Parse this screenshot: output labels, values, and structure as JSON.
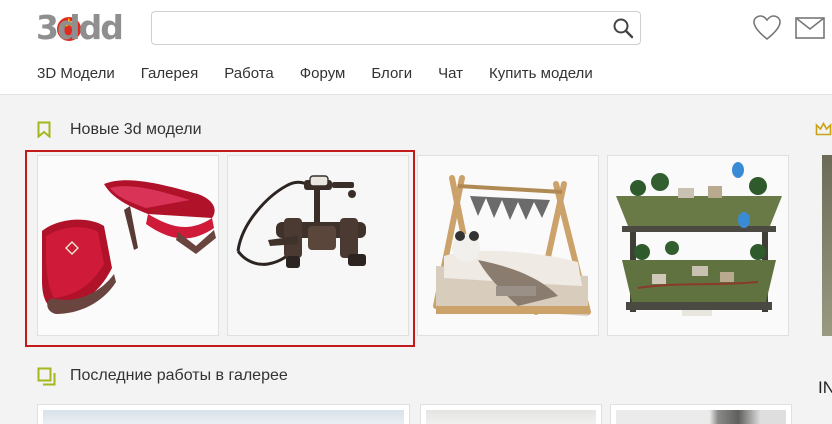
{
  "header": {
    "logo_text": "3ddd",
    "search": {
      "value": "",
      "placeholder": ""
    },
    "icons": [
      "search-icon",
      "heart-icon",
      "mail-icon"
    ]
  },
  "nav": {
    "items": [
      {
        "label": "3D Модели"
      },
      {
        "label": "Галерея"
      },
      {
        "label": "Работа"
      },
      {
        "label": "Форум"
      },
      {
        "label": "Блоги"
      },
      {
        "label": "Чат"
      },
      {
        "label": "Купить модели"
      }
    ]
  },
  "new_models": {
    "title": "Новые 3d модели",
    "items": [
      {
        "name": "red-heel-slippers"
      },
      {
        "name": "bath-faucet-with-shower"
      },
      {
        "name": "teepee-kids-bed"
      },
      {
        "name": "model-railway-layout"
      }
    ]
  },
  "gallery": {
    "title": "Последние работы в галерее",
    "edge_text": "IN"
  },
  "colors": {
    "accent_green": "#a5b61e",
    "highlight_red": "#c21a1a",
    "logo_red": "#e12a1f"
  }
}
